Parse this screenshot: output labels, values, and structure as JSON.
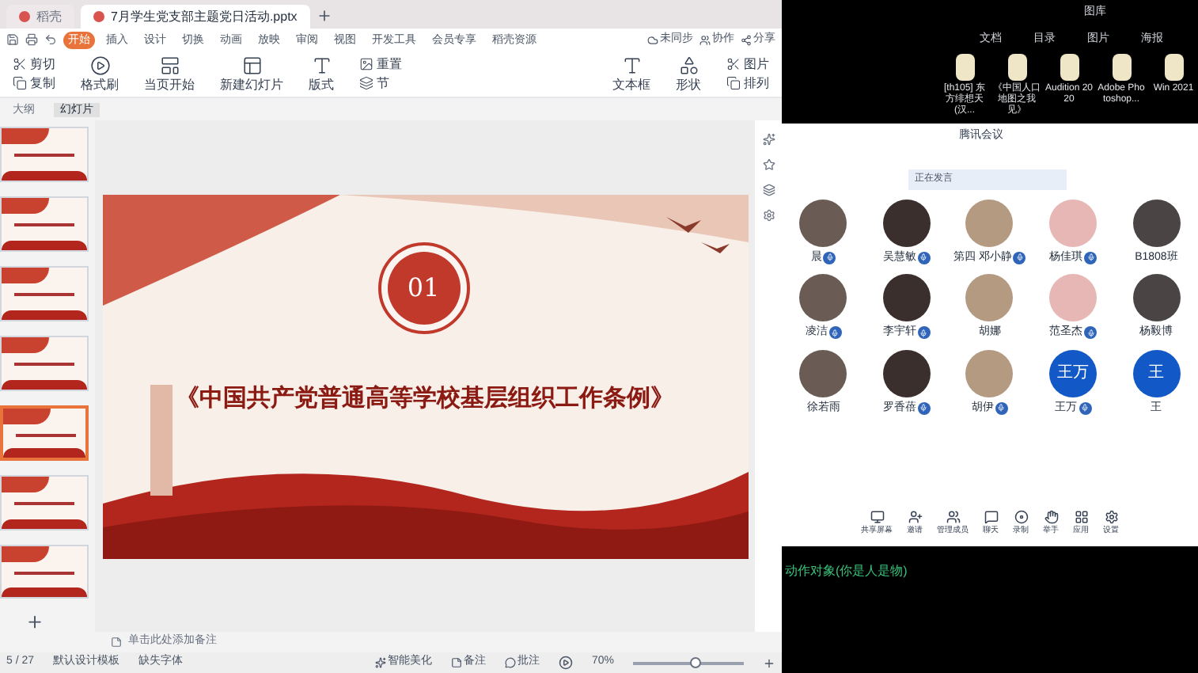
{
  "wps": {
    "tabs": [
      {
        "label": "稻壳",
        "selected": false
      },
      {
        "label": "7月学生党支部主题党日活动.pptx",
        "selected": true
      }
    ],
    "ribbon_tabs": [
      {
        "label": "开始",
        "selected": true
      },
      {
        "label": "插入",
        "selected": false
      },
      {
        "label": "设计",
        "selected": false
      },
      {
        "label": "切换",
        "selected": false
      },
      {
        "label": "动画",
        "selected": false
      },
      {
        "label": "放映",
        "selected": false
      },
      {
        "label": "审阅",
        "selected": false
      },
      {
        "label": "视图",
        "selected": false
      },
      {
        "label": "开发工具",
        "selected": false
      },
      {
        "label": "会员专享",
        "selected": false
      },
      {
        "label": "稻壳资源",
        "selected": false
      }
    ],
    "ribbon_right": [
      "未同步",
      "协作",
      "分享"
    ],
    "tools": [
      {
        "kind": "pair",
        "labels": [
          "剪切",
          "复制"
        ]
      },
      {
        "kind": "big",
        "label": "格式刷"
      },
      {
        "kind": "big",
        "label": "当页开始"
      },
      {
        "kind": "big",
        "label": "新建幻灯片"
      },
      {
        "kind": "big",
        "label": "版式"
      },
      {
        "kind": "pair",
        "labels": [
          "重置",
          "节"
        ]
      }
    ],
    "tools_right": [
      {
        "kind": "big",
        "label": "文本框"
      },
      {
        "kind": "big",
        "label": "形状"
      },
      {
        "kind": "pair",
        "labels": [
          "图片",
          "排列"
        ]
      }
    ],
    "panel_tabs": [
      {
        "label": "大纲",
        "selected": false
      },
      {
        "label": "幻灯片",
        "selected": true
      }
    ],
    "thumbnails": [
      {
        "selected": false
      },
      {
        "selected": false
      },
      {
        "selected": false
      },
      {
        "selected": false
      },
      {
        "selected": true
      },
      {
        "selected": false
      },
      {
        "selected": false
      }
    ],
    "slide": {
      "number": "01",
      "title": "《中国共产党普通高等学校基层组织工作条例》"
    },
    "notes_placeholder": "单击此处添加备注",
    "status_left": [
      "5 / 27",
      "默认设计模板",
      "缺失字体"
    ],
    "status_right": [
      "智能美化",
      "备注",
      "批注"
    ],
    "zoom": {
      "reading": "70%",
      "level": 0.55
    }
  },
  "desktop": {
    "folder": "图库",
    "categories": [
      "文档",
      "目录",
      "图片",
      "海报"
    ],
    "icons": [
      {
        "label": "[th105] 东方绯想天 (汉..."
      },
      {
        "label": "《中国人口地图之我见》"
      },
      {
        "label": "Audition 2020"
      },
      {
        "label": "Adobe Photoshop..."
      },
      {
        "label": "Win 2021"
      }
    ],
    "terminal_line": "动作对象(你是人是物)"
  },
  "meeting": {
    "title": "腾讯会议",
    "search": "正在发言",
    "participants": [
      {
        "name": "晨",
        "kind": "photo",
        "mic_badge": true
      },
      {
        "name": "吴慧敏",
        "kind": "photo",
        "mic_badge": true
      },
      {
        "name": "第四 邓小静",
        "kind": "photo",
        "mic_badge": true
      },
      {
        "name": "杨佳琪",
        "kind": "photo",
        "mic_badge": true
      },
      {
        "name": "B1808班",
        "kind": "photo",
        "mic_badge": false
      },
      {
        "name": "凌洁",
        "kind": "photo",
        "mic_badge": true
      },
      {
        "name": "李宇轩",
        "kind": "photo",
        "mic_badge": true
      },
      {
        "name": "胡娜",
        "kind": "photo",
        "mic_badge": false
      },
      {
        "name": "范圣杰",
        "kind": "photo",
        "mic_badge": true
      },
      {
        "name": "杨毅博",
        "kind": "photo",
        "mic_badge": false
      },
      {
        "name": "徐若雨",
        "kind": "photo",
        "mic_badge": false
      },
      {
        "name": "罗香蓓",
        "kind": "photo",
        "mic_badge": true
      },
      {
        "name": "胡伊",
        "kind": "photo",
        "mic_badge": true
      },
      {
        "name": "王万",
        "kind": "initials",
        "initials": "王万",
        "mic_badge": true
      },
      {
        "name": "王",
        "kind": "initials",
        "initials": "王",
        "mic_badge": false
      }
    ],
    "toolbar": [
      "共享屏幕",
      "邀请",
      "管理成员",
      "聊天",
      "录制",
      "举手",
      "应用",
      "设置"
    ]
  }
}
